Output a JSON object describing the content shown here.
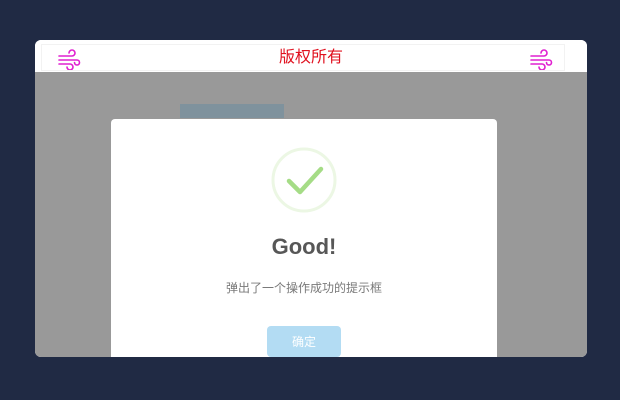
{
  "header": {
    "title": "版权所有",
    "left_icon": "wind-icon",
    "right_icon": "wind-icon",
    "icon_color": "#e020d0",
    "title_color": "#e0111f"
  },
  "dialog": {
    "icon": "success-check-icon",
    "icon_color": "#a5dc86",
    "title": "Good!",
    "message": "弹出了一个操作成功的提示框",
    "confirm_label": "确定",
    "confirm_color": "#b3dcf3"
  },
  "colors": {
    "page_background": "#202a44",
    "overlay": "#999999"
  }
}
